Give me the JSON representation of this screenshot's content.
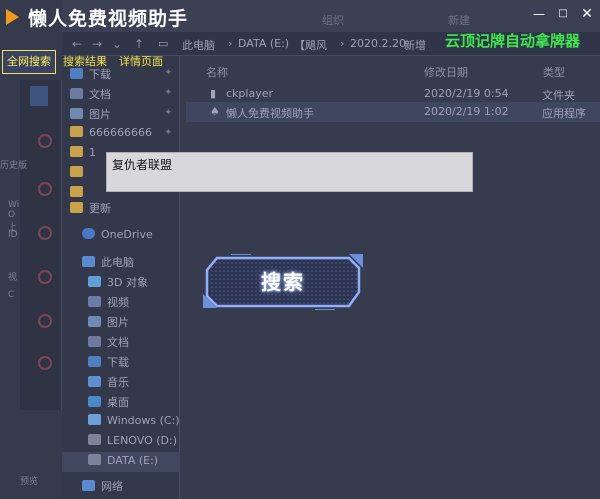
{
  "app": {
    "title": "懒人免费视频助手",
    "promo": "云顶记牌自动拿牌器"
  },
  "tabs": [
    {
      "label": "全网搜索"
    },
    {
      "label": "搜索结果"
    },
    {
      "label": "详情页面"
    }
  ],
  "search": {
    "value": "复仇者联盟",
    "button_label": "搜索"
  },
  "explorer": {
    "ribbon": [
      "组织",
      "新建"
    ],
    "breadcrumb": [
      "此电脑",
      "DATA (E:)",
      "【飓风",
      "2020.2.20",
      "新增"
    ],
    "columns": {
      "name": "名称",
      "date": "修改日期",
      "type": "类型"
    },
    "files": [
      {
        "name": "ckplayer",
        "date": "2020/2/19 0:54",
        "type": "文件夹"
      },
      {
        "name": "懒人免费视频助手",
        "date": "2020/2/19 1:02",
        "type": "应用程序"
      }
    ],
    "quick_access": [
      "下载",
      "文档",
      "图片",
      "666666666",
      "1",
      "",
      "",
      "更新"
    ],
    "onedrive": "OneDrive",
    "this_pc": "此电脑",
    "pc_items": [
      "3D 对象",
      "视频",
      "图片",
      "文档",
      "下载",
      "音乐",
      "桌面",
      "Windows (C:)",
      "LENOVO (D:)",
      "DATA (E:)"
    ],
    "network": "网络",
    "left_fragments": [
      "历史版",
      "Wi",
      "O",
      "上",
      "ID",
      "视",
      "C",
      "预览"
    ]
  },
  "colors": {
    "accent_tab": "#f2e44a",
    "promo": "#3ee84b",
    "logo": "#f39a1b"
  }
}
